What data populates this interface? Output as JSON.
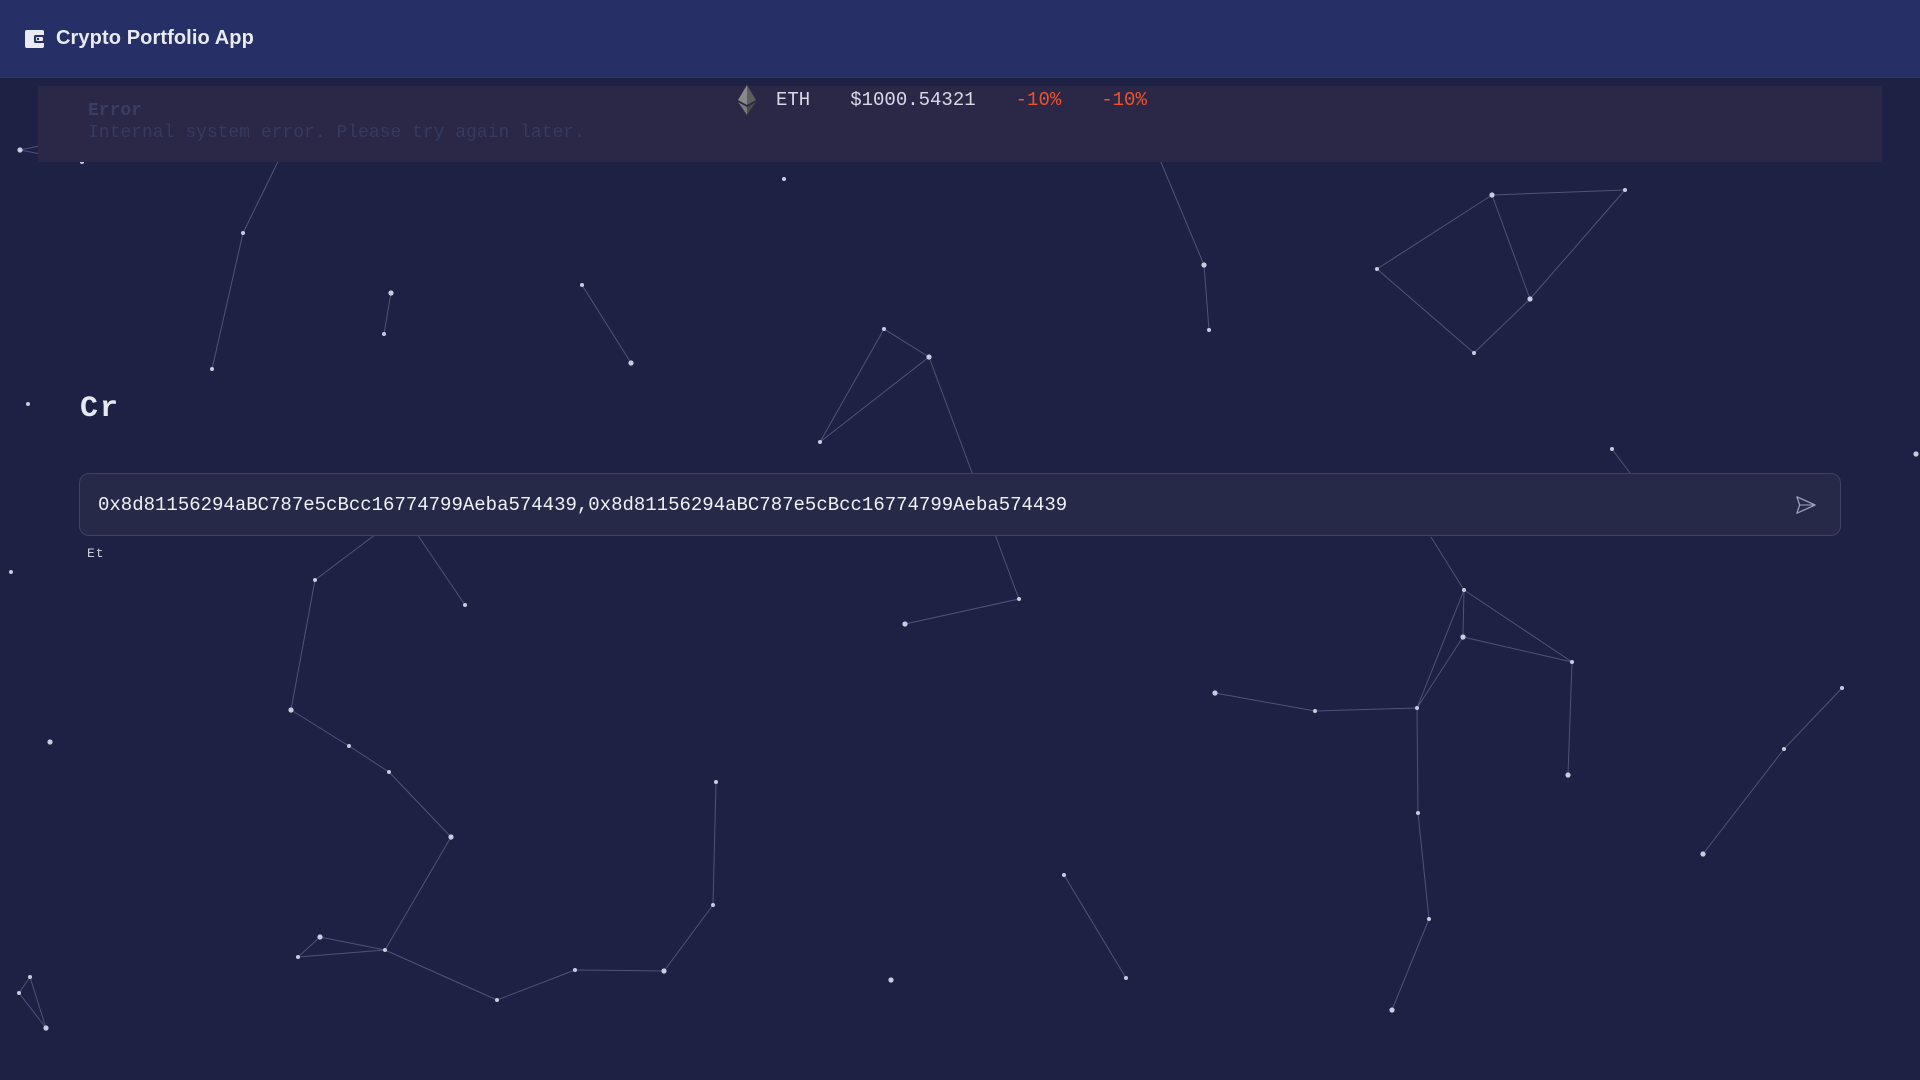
{
  "appbar": {
    "title": "Crypto Portfolio App",
    "icon": "wallet-icon"
  },
  "error": {
    "title": "Error",
    "message": "Internal system error. Please try again later."
  },
  "ticker": {
    "icon": "ethereum-icon",
    "symbol": "ETH",
    "price": "$1000.54321",
    "change_1": "-10%",
    "change_2": "-10%",
    "negative_color": "#f0522a"
  },
  "headline": "Cr",
  "address_input": {
    "value": "0x8d81156294aBC787e5cBcc16774799Aeba574439,0x8d81156294aBC787e5cBcc16774799Aeba574439",
    "send_icon": "send-icon"
  },
  "helper_text": "Et",
  "colors": {
    "background": "#1d2245",
    "appbar": "#263066",
    "input_bg": "#262a48"
  }
}
